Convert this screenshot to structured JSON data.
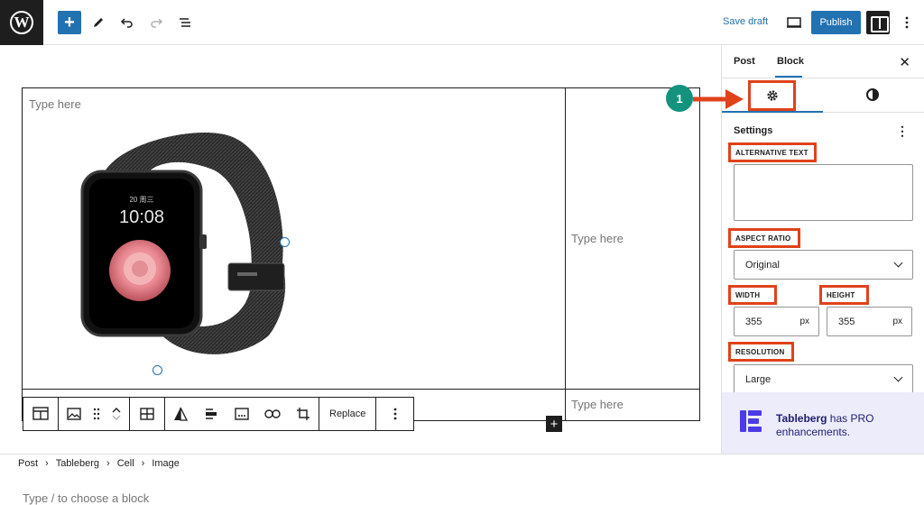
{
  "topbar": {
    "logo_letter": "W",
    "save_draft": "Save draft",
    "publish": "Publish"
  },
  "canvas": {
    "cell_placeholder_1": "Type here",
    "cell_placeholder_2": "Type here",
    "cell_placeholder_3": "Type here",
    "watch_time": "10:08",
    "watch_date": "20 周三",
    "block_placeholder": "Type / to choose a block"
  },
  "block_toolbar": {
    "replace_label": "Replace"
  },
  "sidebar": {
    "tab_post": "Post",
    "tab_block": "Block",
    "settings_label": "Settings",
    "alt_text_label": "ALTERNATIVE TEXT",
    "aspect_ratio_label": "ASPECT RATIO",
    "aspect_ratio_value": "Original",
    "width_label": "WIDTH",
    "height_label": "HEIGHT",
    "width_value": "355",
    "height_value": "355",
    "unit": "px",
    "resolution_label": "RESOLUTION",
    "resolution_value": "Large",
    "promo_brand": "Tableberg",
    "promo_text_1": " has PRO",
    "promo_text_2": "enhancements."
  },
  "annotation": {
    "step_number": "1",
    "accent_color": "#e0421a",
    "step_color": "#13937d"
  },
  "breadcrumb": [
    "Post",
    "Tableberg",
    "Cell",
    "Image"
  ],
  "colors": {
    "primary": "#2271b1",
    "dark": "#1e1e1e",
    "promo_bg": "#edecfb"
  }
}
